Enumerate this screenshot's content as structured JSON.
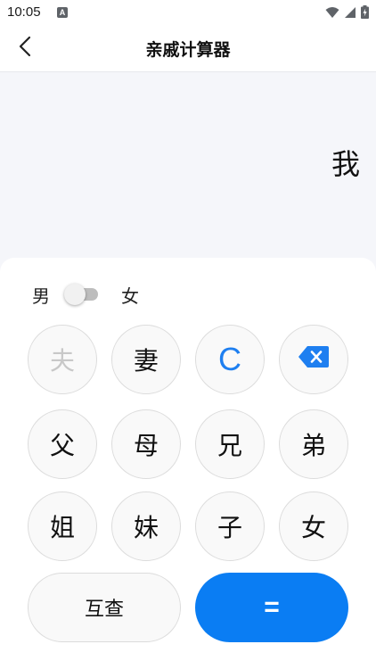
{
  "status_bar": {
    "time": "10:05",
    "notification_letter": "A"
  },
  "app_bar": {
    "title": "亲戚计算器"
  },
  "display": {
    "text": "我"
  },
  "gender": {
    "male_label": "男",
    "female_label": "女",
    "selected": "男"
  },
  "keys": {
    "husband": "夫",
    "wife": "妻",
    "clear": "C",
    "father": "父",
    "mother": "母",
    "elder_brother": "兄",
    "younger_brother": "弟",
    "elder_sister": "姐",
    "younger_sister": "妹",
    "son": "子",
    "daughter": "女",
    "mutual_lookup": "互查",
    "equals": "="
  },
  "colors": {
    "accent": "#0a7df3",
    "clear_text": "#1e7ff0",
    "display_bg": "#f5f6fa"
  }
}
